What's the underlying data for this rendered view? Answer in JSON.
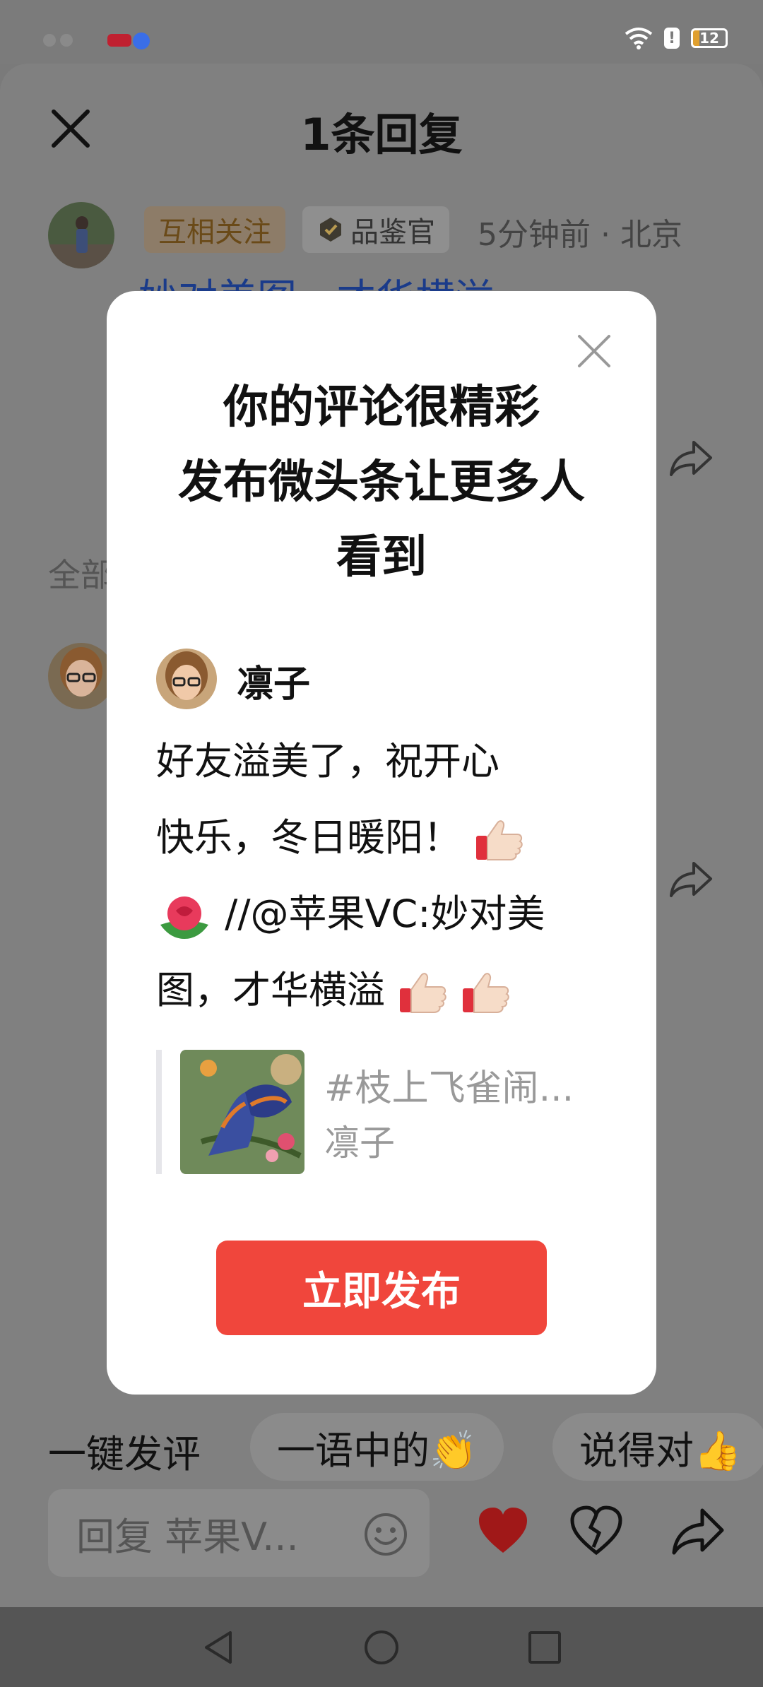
{
  "status_bar": {
    "battery": "12"
  },
  "sheet": {
    "title": "1条回复",
    "comment_header": {
      "badge_follow": "互相关注",
      "badge_critic": "品鉴官",
      "meta": "5分钟前 · 北京"
    },
    "comment_peek": "妙对美图，才华横溢",
    "all_label": "全部"
  },
  "quick_replies": {
    "plain": "一键发评",
    "chip1": "一语中的👏",
    "chip2": "说得对👍"
  },
  "reply_box": {
    "placeholder": "回复 苹果V..."
  },
  "dialog": {
    "headline_1": "你的评论很精彩",
    "headline_2": "发布微头条让更多人",
    "headline_3": "看到",
    "username": "凛子",
    "body_line1": "好友溢美了，祝开心",
    "body_line2": "快乐，冬日暖阳！",
    "body_line3": "//@苹果VC:妙对美",
    "body_line4": "图，才华横溢",
    "quote_title": "#枝上飞雀闹...",
    "quote_author": "凛子",
    "publish_label": "立即发布"
  },
  "colors": {
    "accent": "#f0463c",
    "overlay": "#808080"
  }
}
